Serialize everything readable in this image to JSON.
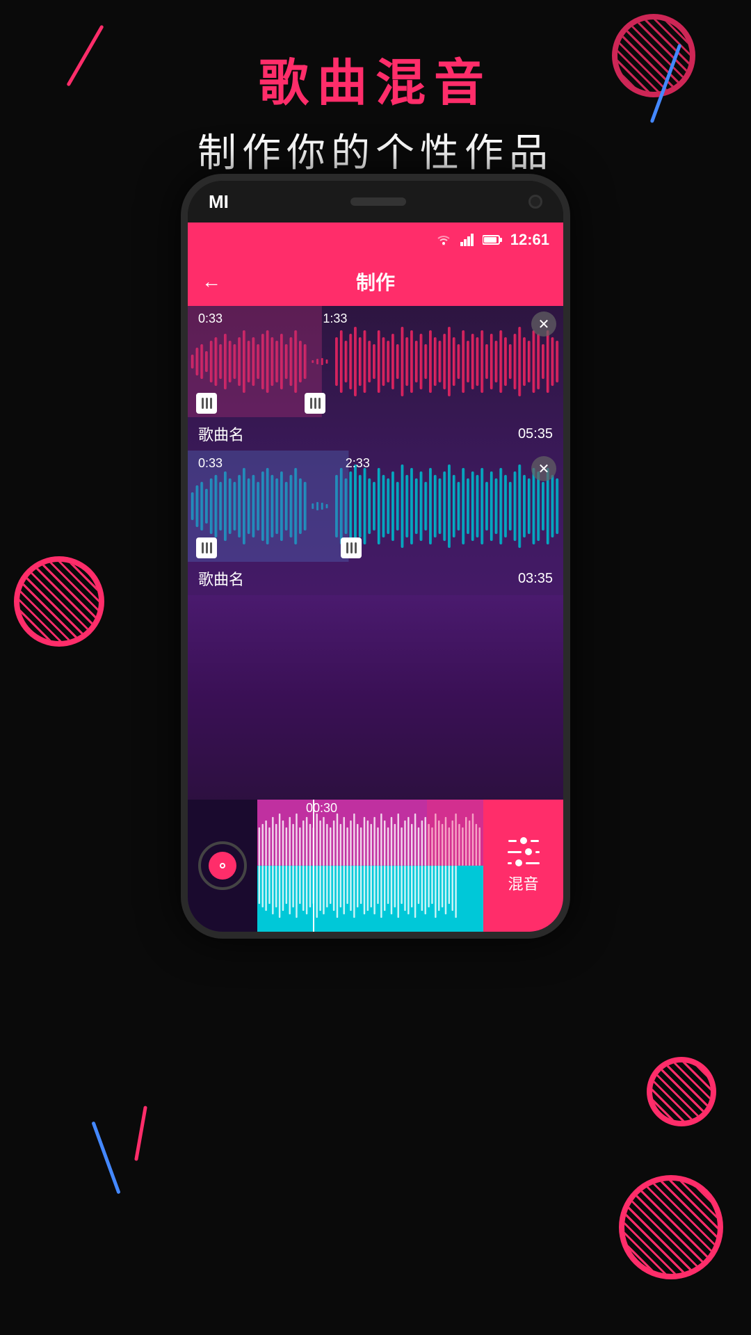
{
  "page": {
    "bg_color": "#0a0a0a"
  },
  "top_text": {
    "title": "歌曲混音",
    "subtitle": "制作你的个性作品"
  },
  "status_bar": {
    "time": "12:61",
    "wifi_icon": "wifi",
    "signal_icon": "signal",
    "battery_icon": "battery"
  },
  "header": {
    "title": "制作",
    "back_label": "←"
  },
  "track1": {
    "name": "歌曲名",
    "duration": "05:35",
    "time_start": "0:33",
    "time_mid": "1:33"
  },
  "track2": {
    "name": "歌曲名",
    "duration": "03:35",
    "time_start": "0:33",
    "time_mid": "2:33"
  },
  "player": {
    "time_marker": "00:30"
  },
  "mix_button": {
    "label": "混音"
  },
  "mi_logo": "MI"
}
